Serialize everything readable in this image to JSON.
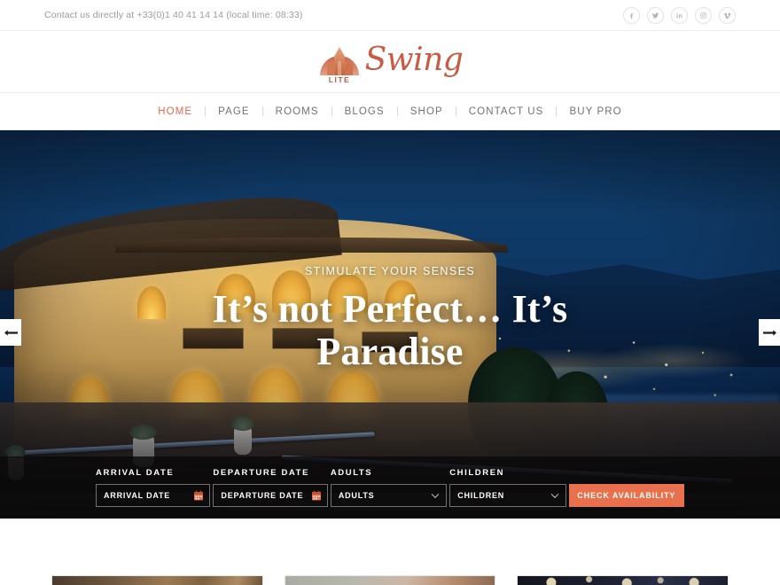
{
  "topbar": {
    "contact": "Contact us directly at +33(0)1 40 41 14 14 (local time: 08:33)",
    "social": [
      {
        "name": "facebook-icon",
        "label": "Facebook"
      },
      {
        "name": "twitter-icon",
        "label": "Twitter"
      },
      {
        "name": "linkedin-icon",
        "label": "LinkedIn"
      },
      {
        "name": "instagram-icon",
        "label": "Instagram"
      },
      {
        "name": "vimeo-icon",
        "label": "Vimeo"
      }
    ]
  },
  "logo": {
    "wordmark": "Swing",
    "sub": "LITE",
    "color": "#c75b43"
  },
  "nav": {
    "items": [
      {
        "label": "HOME",
        "active": true
      },
      {
        "label": "PAGE",
        "active": false
      },
      {
        "label": "ROOMS",
        "active": false
      },
      {
        "label": "BLOGS",
        "active": false
      },
      {
        "label": "SHOP",
        "active": false
      },
      {
        "label": "CONTACT US",
        "active": false
      },
      {
        "label": "BUY PRO",
        "active": false
      }
    ],
    "active_color": "#e4694a"
  },
  "hero": {
    "eyebrow": "STIMULATE YOUR SENSES",
    "title": "It’s not Perfect… It’s Paradise",
    "prev_label": "Previous slide",
    "next_label": "Next slide"
  },
  "booking": {
    "arrival": {
      "label": "ARRIVAL DATE",
      "placeholder": "ARRIVAL DATE",
      "value": "ARRIVAL DATE"
    },
    "departure": {
      "label": "DEPARTURE DATE",
      "placeholder": "DEPARTURE DATE",
      "value": "DEPARTURE DATE"
    },
    "adults": {
      "label": "ADULTS",
      "value": "ADULTS"
    },
    "children": {
      "label": "CHILDREN",
      "value": "CHILDREN"
    },
    "submit": "CHECK AVAILABILITY",
    "button_color": "#e8704c"
  },
  "cards": [
    {
      "name": "card-one"
    },
    {
      "name": "card-two"
    },
    {
      "name": "card-three"
    }
  ]
}
